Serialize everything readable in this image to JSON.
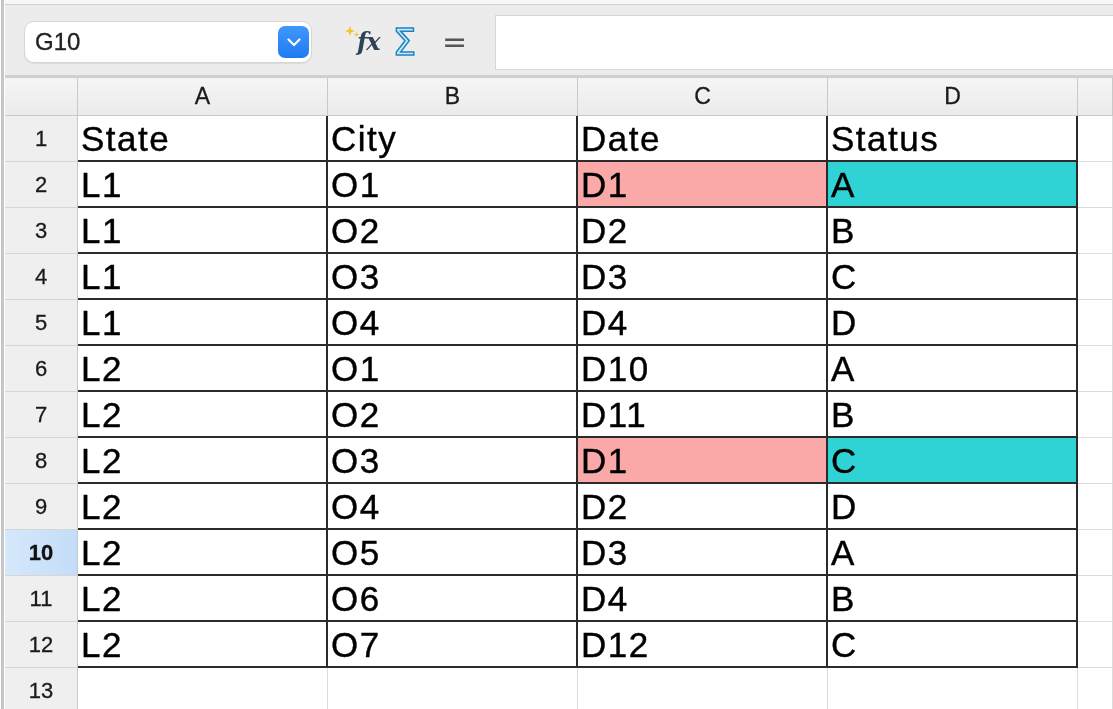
{
  "formula_bar": {
    "name_box": "G10",
    "tools": [
      {
        "kind": "function",
        "glyph": "fx"
      },
      {
        "kind": "sum",
        "glyph": "Σ"
      },
      {
        "kind": "formula",
        "glyph": "="
      }
    ]
  },
  "sheet": {
    "columns": [
      "A",
      "B",
      "C",
      "D"
    ],
    "rows": [
      {
        "number": "1",
        "selected": false,
        "cells": [
          {
            "text": "State"
          },
          {
            "text": "City"
          },
          {
            "text": "Date"
          },
          {
            "text": "Status"
          }
        ]
      },
      {
        "number": "2",
        "selected": false,
        "cells": [
          {
            "text": "L1"
          },
          {
            "text": "O1"
          },
          {
            "text": "D1",
            "color": "#faa9a8"
          },
          {
            "text": "A",
            "color": "#2fd3d5"
          }
        ]
      },
      {
        "number": "3",
        "selected": false,
        "cells": [
          {
            "text": "L1"
          },
          {
            "text": "O2"
          },
          {
            "text": "D2"
          },
          {
            "text": "B"
          }
        ]
      },
      {
        "number": "4",
        "selected": false,
        "cells": [
          {
            "text": "L1"
          },
          {
            "text": "O3"
          },
          {
            "text": "D3"
          },
          {
            "text": "C"
          }
        ]
      },
      {
        "number": "5",
        "selected": false,
        "cells": [
          {
            "text": "L1"
          },
          {
            "text": "O4"
          },
          {
            "text": "D4"
          },
          {
            "text": "D"
          }
        ]
      },
      {
        "number": "6",
        "selected": false,
        "cells": [
          {
            "text": "L2"
          },
          {
            "text": "O1"
          },
          {
            "text": "D10"
          },
          {
            "text": "A"
          }
        ]
      },
      {
        "number": "7",
        "selected": false,
        "cells": [
          {
            "text": "L2"
          },
          {
            "text": "O2"
          },
          {
            "text": "D11"
          },
          {
            "text": "B"
          }
        ]
      },
      {
        "number": "8",
        "selected": false,
        "cells": [
          {
            "text": "L2"
          },
          {
            "text": "O3"
          },
          {
            "text": "D1",
            "color": "#faa9a8"
          },
          {
            "text": "C",
            "color": "#2fd3d5"
          }
        ]
      },
      {
        "number": "9",
        "selected": false,
        "cells": [
          {
            "text": "L2"
          },
          {
            "text": "O4"
          },
          {
            "text": "D2"
          },
          {
            "text": "D"
          }
        ]
      },
      {
        "number": "10",
        "selected": true,
        "cells": [
          {
            "text": "L2"
          },
          {
            "text": "O5"
          },
          {
            "text": "D3"
          },
          {
            "text": "A"
          }
        ]
      },
      {
        "number": "11",
        "selected": false,
        "cells": [
          {
            "text": "L2"
          },
          {
            "text": "O6"
          },
          {
            "text": "D4"
          },
          {
            "text": "B"
          }
        ]
      },
      {
        "number": "12",
        "selected": false,
        "cells": [
          {
            "text": "L2"
          },
          {
            "text": "O7"
          },
          {
            "text": "D12"
          },
          {
            "text": "C"
          }
        ]
      },
      {
        "number": "13",
        "selected": false
      }
    ]
  }
}
